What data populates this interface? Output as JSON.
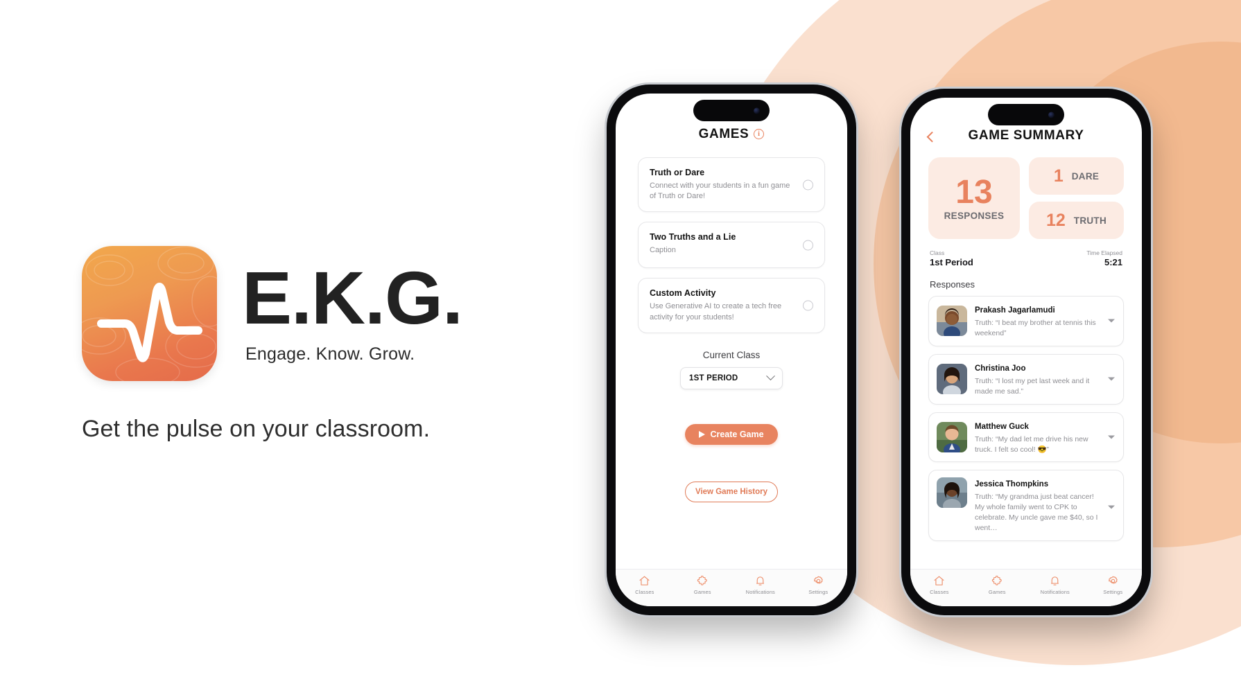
{
  "brand": {
    "title": "E.K.G.",
    "subtitle": "Engage. Know. Grow.",
    "tagline": "Get the pulse on your classroom.",
    "icon_name": "ekg-pulse-icon",
    "accent": "#e8825e",
    "accent_soft": "#fcebe3"
  },
  "background": {
    "ring_colors": [
      "#fae0cf",
      "#f7c8a6",
      "#f2b98f"
    ]
  },
  "phone1": {
    "screen_title": "GAMES",
    "info_icon": "i",
    "games": [
      {
        "title": "Truth or Dare",
        "desc": "Connect with your students in a fun game of Truth or Dare!",
        "selected": false
      },
      {
        "title": "Two Truths and a Lie",
        "desc": "Caption",
        "selected": false
      },
      {
        "title": "Custom Activity",
        "desc": "Use Generative AI to create a tech free activity for your students!",
        "selected": false
      }
    ],
    "current_class_label": "Current Class",
    "class_value": "1ST PERIOD",
    "create_button": "Create Game",
    "history_button": "View Game History",
    "tabs": [
      {
        "label": "Classes",
        "icon": "home-icon"
      },
      {
        "label": "Games",
        "icon": "puzzle-icon"
      },
      {
        "label": "Notifications",
        "icon": "bell-icon"
      },
      {
        "label": "Settings",
        "icon": "gear-icon"
      }
    ]
  },
  "phone2": {
    "screen_title": "GAME SUMMARY",
    "back_icon": "back-chevron-icon",
    "stats": {
      "responses_value": "13",
      "responses_label": "RESPONSES",
      "dare_value": "1",
      "dare_label": "DARE",
      "truth_value": "12",
      "truth_label": "TRUTH"
    },
    "meta": {
      "class_key": "Class",
      "class_value": "1st Period",
      "time_key": "Time Elapsed",
      "time_value": "5:21"
    },
    "responses_heading": "Responses",
    "responses": [
      {
        "name": "Prakash Jagarlamudi",
        "quote": "Truth: “I beat my brother at tennis this weekend”",
        "avatar": "student-photo"
      },
      {
        "name": "Christina Joo",
        "quote": "Truth: “I lost my pet last week and it made me sad.”",
        "avatar": "student-photo"
      },
      {
        "name": "Matthew Guck",
        "quote": "Truth: “My dad let me drive his new truck. I felt so cool! 😎”",
        "avatar": "student-photo"
      },
      {
        "name": "Jessica Thompkins",
        "quote": "Truth: “My grandma just beat cancer! My whole family went to CPK to celebrate. My uncle gave me $40, so I went…",
        "avatar": "student-photo"
      }
    ],
    "tabs": [
      {
        "label": "Classes",
        "icon": "home-icon"
      },
      {
        "label": "Games",
        "icon": "puzzle-icon"
      },
      {
        "label": "Notifications",
        "icon": "bell-icon"
      },
      {
        "label": "Settings",
        "icon": "gear-icon"
      }
    ]
  }
}
